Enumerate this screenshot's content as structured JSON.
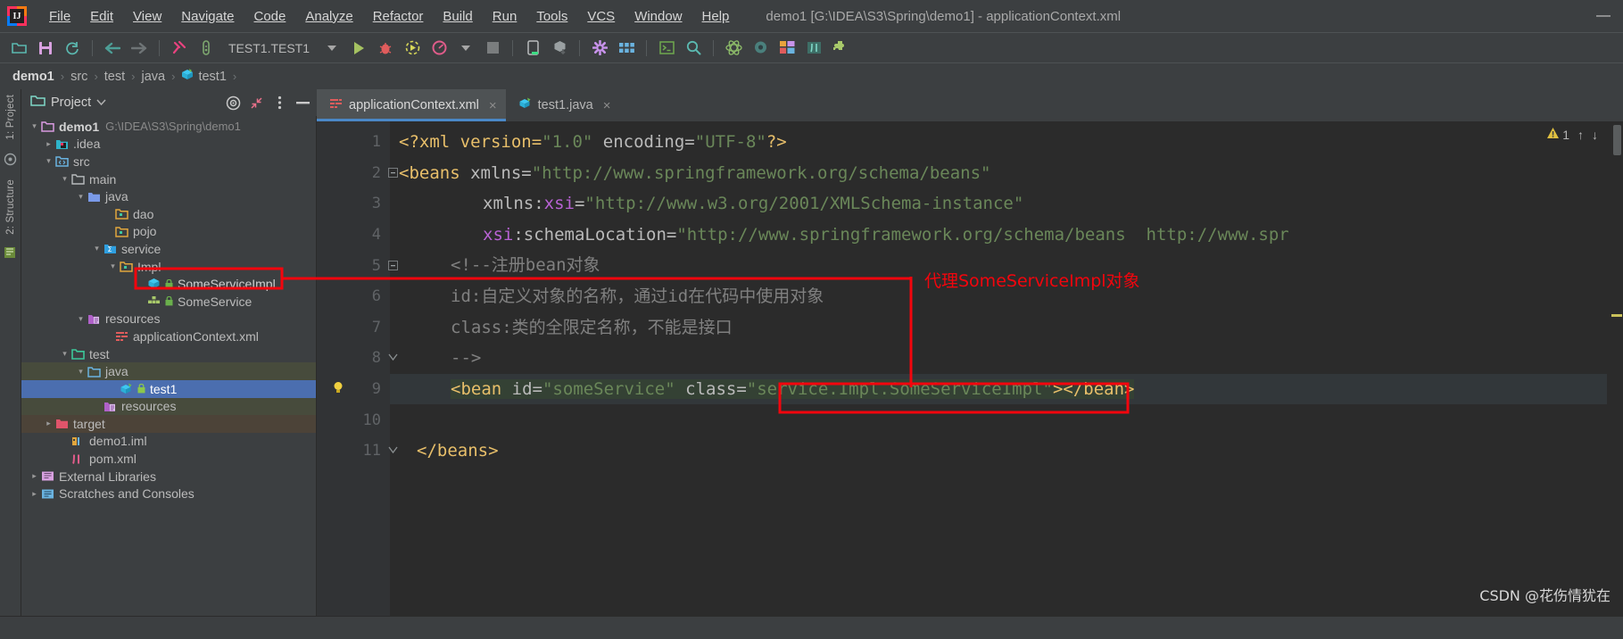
{
  "window": {
    "title": "demo1 [G:\\IDEA\\S3\\Spring\\demo1] - applicationContext.xml",
    "minimize_label": "—"
  },
  "menubar": {
    "logo_text": "IJ",
    "items": [
      {
        "label": "File",
        "mnemonic": "F"
      },
      {
        "label": "Edit",
        "mnemonic": "E"
      },
      {
        "label": "View",
        "mnemonic": "V"
      },
      {
        "label": "Navigate",
        "mnemonic": "N"
      },
      {
        "label": "Code",
        "mnemonic": "C"
      },
      {
        "label": "Analyze",
        "mnemonic": "z"
      },
      {
        "label": "Refactor",
        "mnemonic": "R"
      },
      {
        "label": "Build",
        "mnemonic": "B"
      },
      {
        "label": "Run",
        "mnemonic": "u"
      },
      {
        "label": "Tools",
        "mnemonic": "T"
      },
      {
        "label": "VCS",
        "mnemonic": "S"
      },
      {
        "label": "Window",
        "mnemonic": "W"
      },
      {
        "label": "Help",
        "mnemonic": "H"
      }
    ]
  },
  "toolbar": {
    "icons": [
      "open-project-icon",
      "save-all-icon",
      "sync-refresh-icon",
      "navigate-back-icon",
      "navigate-forward-icon",
      "build-hammer-icon",
      "run-test-tube-icon"
    ],
    "run_configuration": "TEST1.TEST1",
    "run_config_dropdown": "run-config-chevron-icon",
    "right_icons": [
      "run-icon",
      "debug-icon",
      "run-with-coverage-icon",
      "profiler-icon",
      "profiler-chevron-icon",
      "stop-icon",
      "device-manager-icon",
      "sync-gradle-icon",
      "settings-gear-icon",
      "layout-grid-icon",
      "terminal-icon",
      "search-everywhere-icon",
      "spring-atom-icon",
      "database-icon",
      "ui-designer-icon",
      "maven-icon",
      "plugins-puzzle-icon"
    ]
  },
  "breadcrumb": {
    "items": [
      {
        "label": "demo1",
        "icon": "",
        "bold": true
      },
      {
        "label": "src",
        "icon": ""
      },
      {
        "label": "test",
        "icon": ""
      },
      {
        "label": "java",
        "icon": ""
      },
      {
        "label": "test1",
        "icon": "package-icon"
      }
    ],
    "separator": "›"
  },
  "left_strip": {
    "tabs": [
      {
        "label": "1: Project",
        "name": "tool-window-project"
      },
      {
        "label": "2: Structure",
        "name": "tool-window-structure"
      }
    ],
    "icons": [
      "favorites-star-icon",
      "bookmarks-icon"
    ]
  },
  "project_panel": {
    "title": "Project",
    "title_chevron": "chevron-down-icon",
    "header_icons": [
      "select-opened-file-icon",
      "collapse-all-icon",
      "panel-options-icon",
      "hide-panel-icon"
    ],
    "tree": [
      {
        "label": "demo1",
        "sub": "G:\\IDEA\\S3\\Spring\\demo1",
        "indent": 0,
        "arrow": "v",
        "icon": "module-folder-icon",
        "bold": true,
        "state": "none"
      },
      {
        "label": ".idea",
        "sub": "",
        "indent": 1,
        "arrow": ">",
        "icon": "idea-folder-icon",
        "bold": false,
        "state": "none"
      },
      {
        "label": "src",
        "sub": "",
        "indent": 1,
        "arrow": "v",
        "icon": "source-root-icon",
        "bold": false,
        "state": "none"
      },
      {
        "label": "main",
        "sub": "",
        "indent": 2,
        "arrow": "v",
        "icon": "folder-icon",
        "bold": false,
        "state": "none"
      },
      {
        "label": "java",
        "sub": "",
        "indent": 3,
        "arrow": "v",
        "icon": "java-source-folder-icon",
        "bold": false,
        "state": "none"
      },
      {
        "label": "dao",
        "sub": "",
        "indent": 4,
        "arrow": "",
        "icon": "package-folder-icon",
        "bold": false,
        "state": "none"
      },
      {
        "label": "pojo",
        "sub": "",
        "indent": 4,
        "arrow": "",
        "icon": "package-folder-icon",
        "bold": false,
        "state": "none"
      },
      {
        "label": "service",
        "sub": "",
        "indent": 4,
        "arrow": "v",
        "icon": "spring-package-icon",
        "bold": false,
        "state": "none"
      },
      {
        "label": "Impl",
        "sub": "",
        "indent": 5,
        "arrow": "v",
        "icon": "package-folder-icon",
        "bold": false,
        "state": "none"
      },
      {
        "label": "SomeServiceImpl",
        "sub": "",
        "indent": 6,
        "arrow": "",
        "icon": "spring-bean-class-icon",
        "lock": true,
        "bold": false,
        "state": "highlighted"
      },
      {
        "label": "SomeService",
        "sub": "",
        "indent": 6,
        "arrow": "",
        "icon": "java-interface-icon",
        "lock": true,
        "bold": false,
        "state": "none"
      },
      {
        "label": "resources",
        "sub": "",
        "indent": 3,
        "arrow": "v",
        "icon": "resources-folder-icon",
        "bold": false,
        "state": "none"
      },
      {
        "label": "applicationContext.xml",
        "sub": "",
        "indent": 4,
        "arrow": "",
        "icon": "xml-file-icon",
        "bold": false,
        "state": "none"
      },
      {
        "label": "test",
        "sub": "",
        "indent": 2,
        "arrow": "v",
        "icon": "test-folder-icon",
        "bold": false,
        "state": "none"
      },
      {
        "label": "java",
        "sub": "",
        "indent": 3,
        "arrow": "v",
        "icon": "test-source-folder-icon",
        "bold": false,
        "state": "testsrc"
      },
      {
        "label": "test1",
        "sub": "",
        "indent": 4,
        "arrow": "",
        "icon": "test-class-icon",
        "lock": true,
        "bold": false,
        "state": "selected"
      },
      {
        "label": "resources",
        "sub": "",
        "indent": 3,
        "arrow": "",
        "icon": "resources-folder-icon",
        "bold": false,
        "state": "testsrc"
      },
      {
        "label": "target",
        "sub": "",
        "indent": 1,
        "arrow": ">",
        "icon": "excluded-folder-icon",
        "bold": false,
        "state": "excluded"
      },
      {
        "label": "demo1.iml",
        "sub": "",
        "indent": 2,
        "arrow": "",
        "icon": "iml-file-icon",
        "bold": false,
        "state": "none"
      },
      {
        "label": "pom.xml",
        "sub": "",
        "indent": 2,
        "arrow": "",
        "icon": "maven-pom-icon",
        "bold": false,
        "state": "none"
      },
      {
        "label": "External Libraries",
        "sub": "",
        "indent": 0,
        "arrow": ">",
        "icon": "external-libraries-icon",
        "bold": false,
        "state": "none"
      },
      {
        "label": "Scratches and Consoles",
        "sub": "",
        "indent": 0,
        "arrow": ">",
        "icon": "scratches-icon",
        "bold": false,
        "state": "none"
      }
    ]
  },
  "editor": {
    "tabs": [
      {
        "label": "applicationContext.xml",
        "icon": "xml-file-icon",
        "active": true,
        "close": "×"
      },
      {
        "label": "test1.java",
        "icon": "java-class-icon",
        "active": false,
        "close": "×"
      }
    ],
    "inspection": {
      "warning_count": "1",
      "warning_icon": "warning-triangle-icon",
      "prev_icon": "↑",
      "next_icon": "↓"
    },
    "lines": [
      {
        "n": "1",
        "fold": "",
        "bulb": false
      },
      {
        "n": "2",
        "fold": "minus",
        "bulb": false
      },
      {
        "n": "3",
        "fold": "",
        "bulb": false
      },
      {
        "n": "4",
        "fold": "",
        "bulb": false
      },
      {
        "n": "5",
        "fold": "minus",
        "bulb": false
      },
      {
        "n": "6",
        "fold": "",
        "bulb": false
      },
      {
        "n": "7",
        "fold": "",
        "bulb": false
      },
      {
        "n": "8",
        "fold": "end",
        "bulb": false
      },
      {
        "n": "9",
        "fold": "",
        "bulb": true
      },
      {
        "n": "10",
        "fold": "",
        "bulb": false
      },
      {
        "n": "11",
        "fold": "end",
        "bulb": false
      }
    ],
    "code": {
      "l1_prolog": "<?xml version=",
      "l1_ver": "\"1.0\"",
      "l1_enc_attr": " encoding=",
      "l1_enc": "\"UTF-8\"",
      "l1_close": "?>",
      "l2_tag": "<beans",
      "l2_attr": " xmlns=",
      "l2_val": "\"http://www.springframework.org/schema/beans\"",
      "l3_pre": "xmlns:",
      "l3_ns": "xsi",
      "l3_eq": "=",
      "l3_val": "\"http://www.w3.org/2001/XMLSchema-instance\"",
      "l4_ns": "xsi",
      "l4_attr": ":schemaLocation=",
      "l4_val": "\"http://www.springframework.org/schema/beans  http://www.spr",
      "l5_comment": "<!--注册bean对象",
      "l6_comment": "id:自定义对象的名称，通过id在代码中使用对象",
      "l7_comment": "class:类的全限定名称，不能是接口",
      "l8_comment": "-->",
      "l9_tag": "<bean",
      "l9_attr_id": " id=",
      "l9_val_id": "\"someService\"",
      "l9_attr_class": " class=",
      "l9_val_class": "\"service.Impl.SomeServiceImpl\"",
      "l9_gt": ">",
      "l9_endtag": "</bean>",
      "l11_endtag": "</beans>"
    }
  },
  "annotation": {
    "label": "代理SomeServiceImpl对象",
    "color": "#f3050d"
  },
  "watermark": "CSDN @花伤情犹在",
  "colors": {
    "accent_red": "#f3050d",
    "selection_blue": "#4b6eaf",
    "editor_bg": "#2b2b2b",
    "panel_bg": "#3c3f41",
    "string_green": "#6a8759",
    "tag_orange": "#e8bf6a"
  }
}
